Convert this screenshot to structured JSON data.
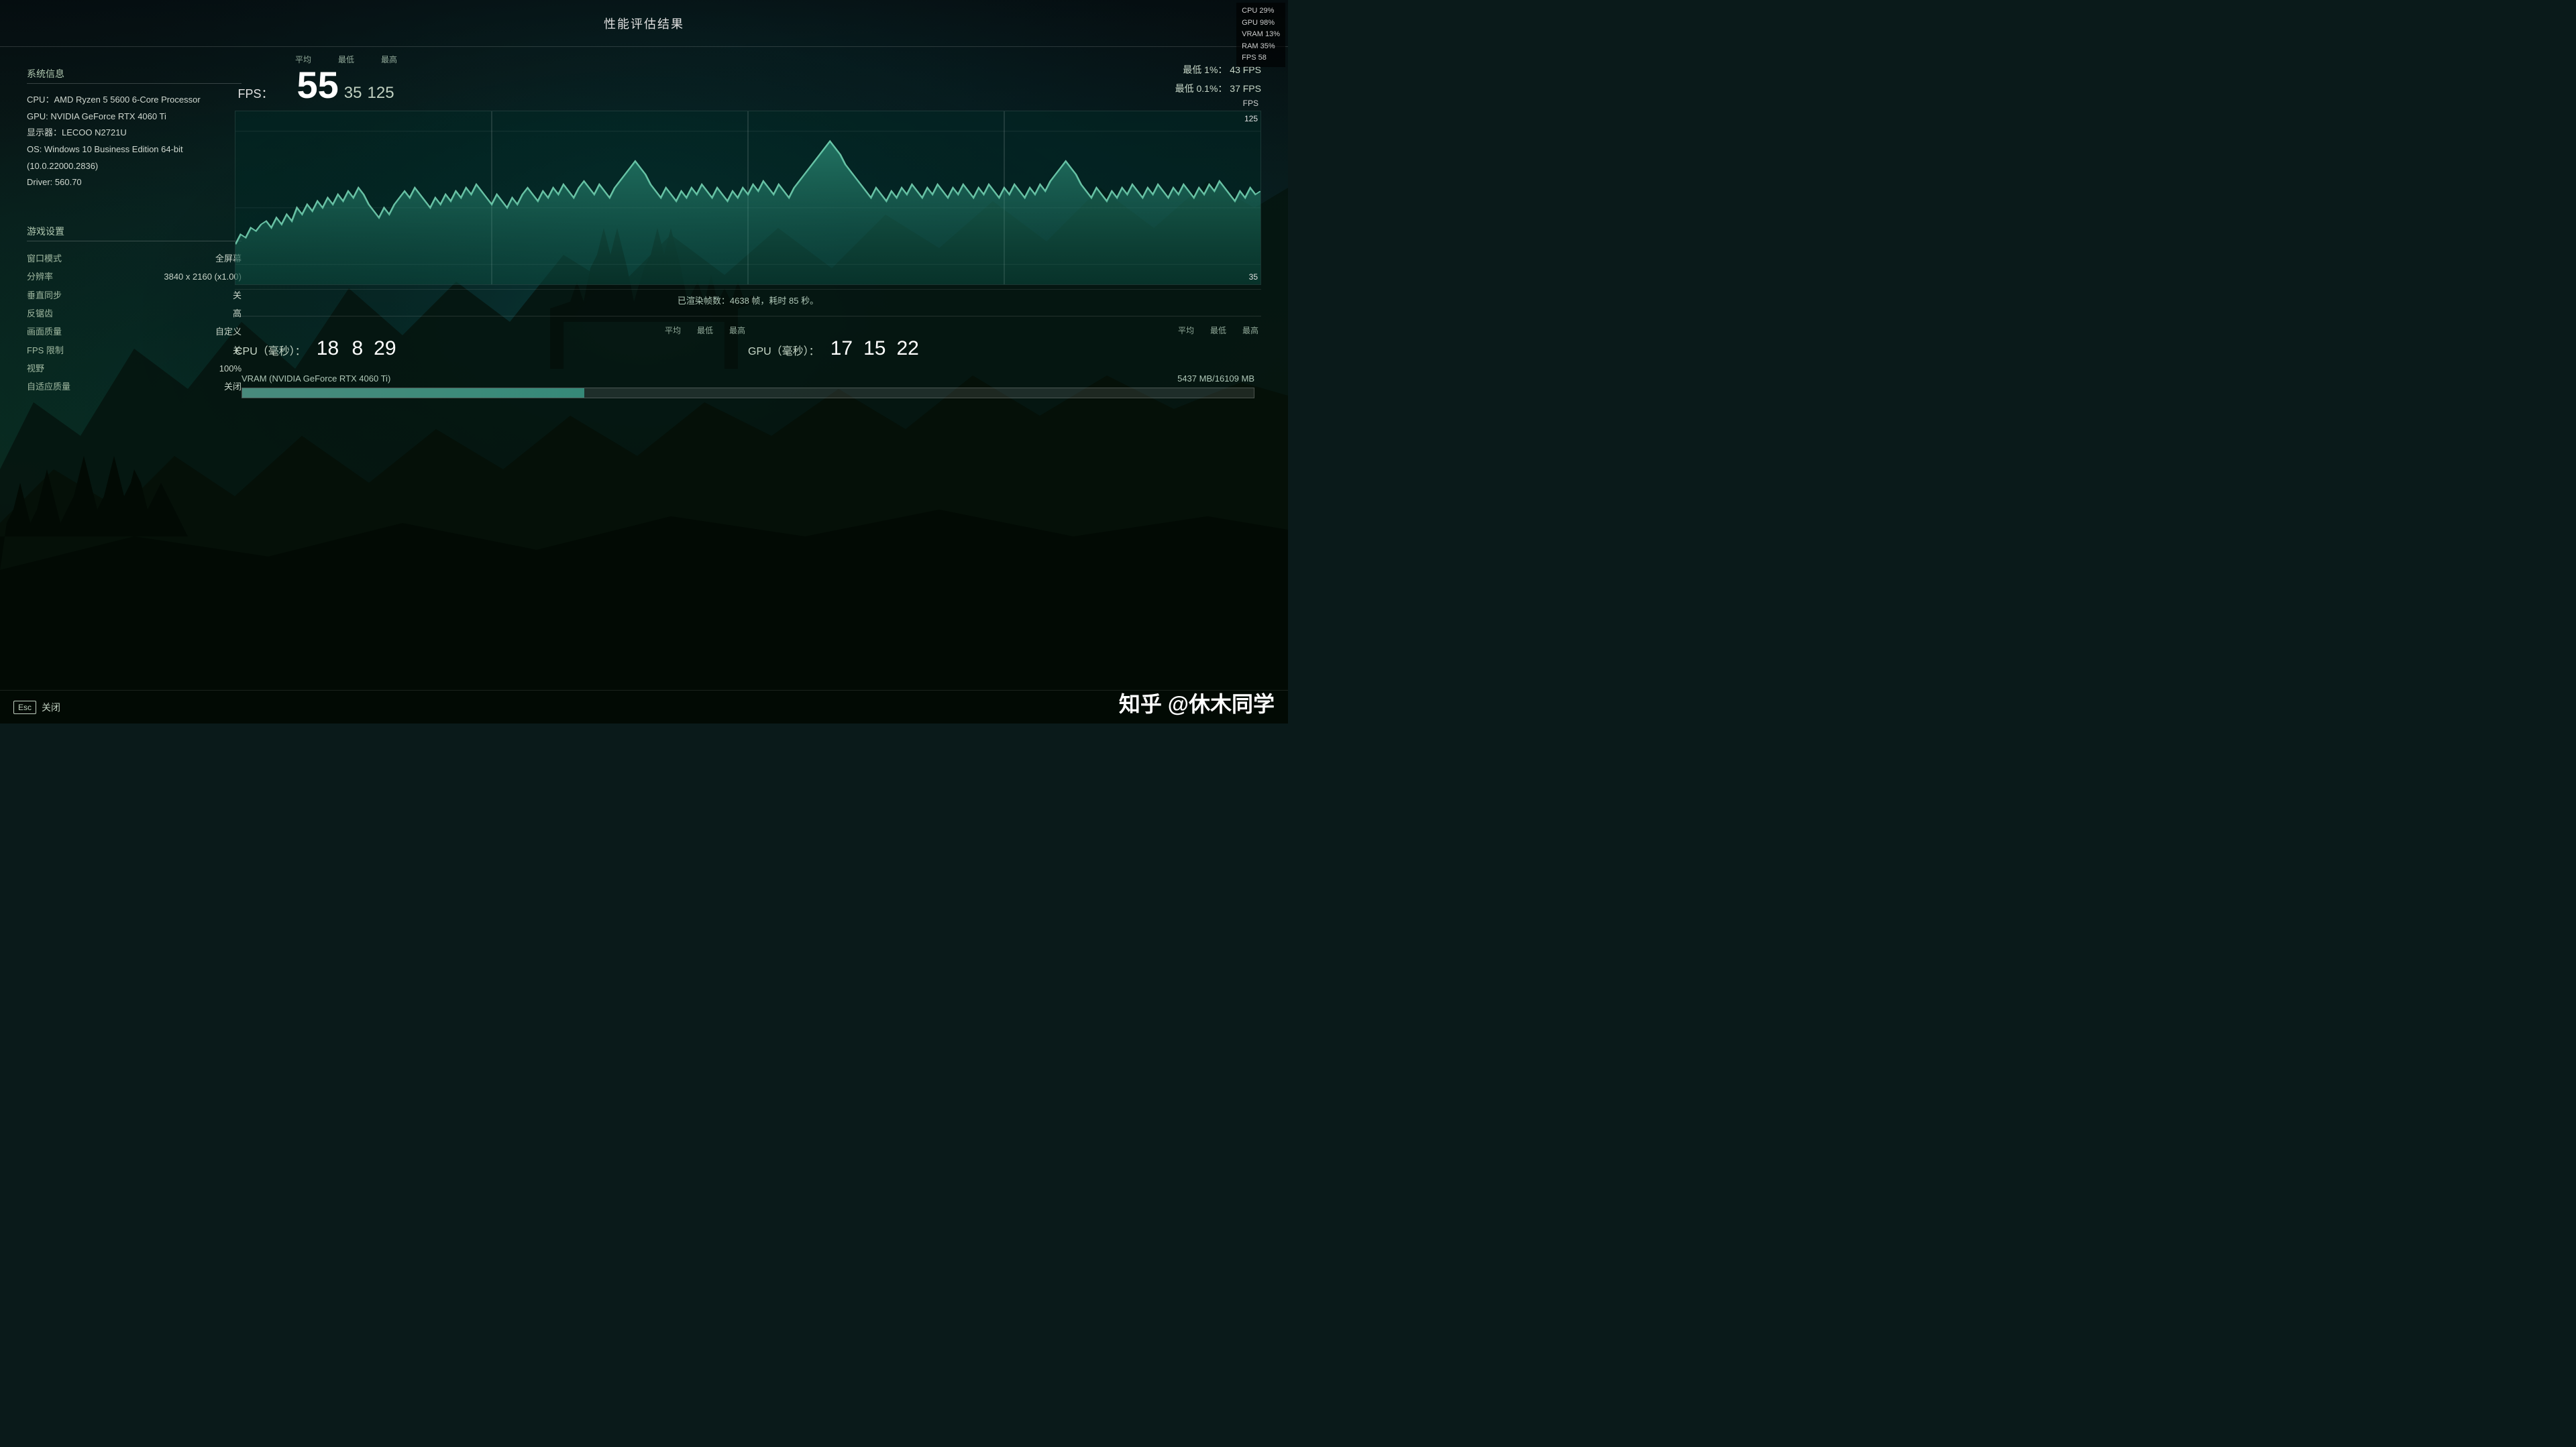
{
  "title": "性能评估结果",
  "hud": {
    "cpu": "CPU 29%",
    "gpu": "GPU 98%",
    "vram": "VRAM 13%",
    "ram": "RAM 35%",
    "fps": "FPS  58"
  },
  "system_info": {
    "section_title": "系统信息",
    "cpu": "CPU：AMD Ryzen 5 5600 6-Core Processor",
    "gpu": "GPU: NVIDIA GeForce RTX 4060 Ti",
    "display": "显示器：LECOO N2721U",
    "os": "OS: Windows 10 Business Edition 64-bit (10.0.22000.2836)",
    "driver": "Driver: 560.70"
  },
  "game_settings": {
    "section_title": "游戏设置",
    "rows": [
      {
        "label": "窗口模式",
        "value": "全屏幕"
      },
      {
        "label": "分辨率",
        "value": "3840 x 2160 (x1.00)"
      },
      {
        "label": "垂直同步",
        "value": "关"
      },
      {
        "label": "反锯齿",
        "value": "高"
      },
      {
        "label": "画面质量",
        "value": "自定义"
      },
      {
        "label": "FPS 限制",
        "value": "关"
      },
      {
        "label": "视野",
        "value": "100%"
      },
      {
        "label": "自适应质量",
        "value": "关闭"
      }
    ]
  },
  "fps": {
    "label": "FPS：",
    "avg_label": "平均",
    "min_label": "最低",
    "max_label": "最高",
    "avg_value": "55",
    "min_value": "35",
    "max_value": "125",
    "p1_label": "最低 1%：",
    "p1_value": "43 FPS",
    "p01_label": "最低 0.1%：",
    "p01_value": "37 FPS",
    "fps_scale_label": "FPS",
    "fps_scale_top": "125",
    "fps_scale_bottom": "35",
    "rendered_info": "已渲染帧数：4638 帧，耗时 85 秒。"
  },
  "cpu_ms": {
    "label": "CPU（毫秒）：",
    "avg_label": "平均",
    "min_label": "最低",
    "max_label": "最高",
    "avg_value": "18",
    "min_value": "8",
    "max_value": "29"
  },
  "gpu_ms": {
    "label": "GPU（毫秒）：",
    "avg_label": "平均",
    "min_label": "最低",
    "max_label": "最高",
    "avg_value": "17",
    "min_value": "15",
    "max_value": "22"
  },
  "vram": {
    "label": "VRAM (NVIDIA GeForce RTX 4060 Ti)",
    "value": "5437 MB/16109 MB",
    "fill_percent": 33.8
  },
  "close": {
    "esc": "Esc",
    "label": "关闭"
  },
  "watermark": "知乎 @休木同学"
}
